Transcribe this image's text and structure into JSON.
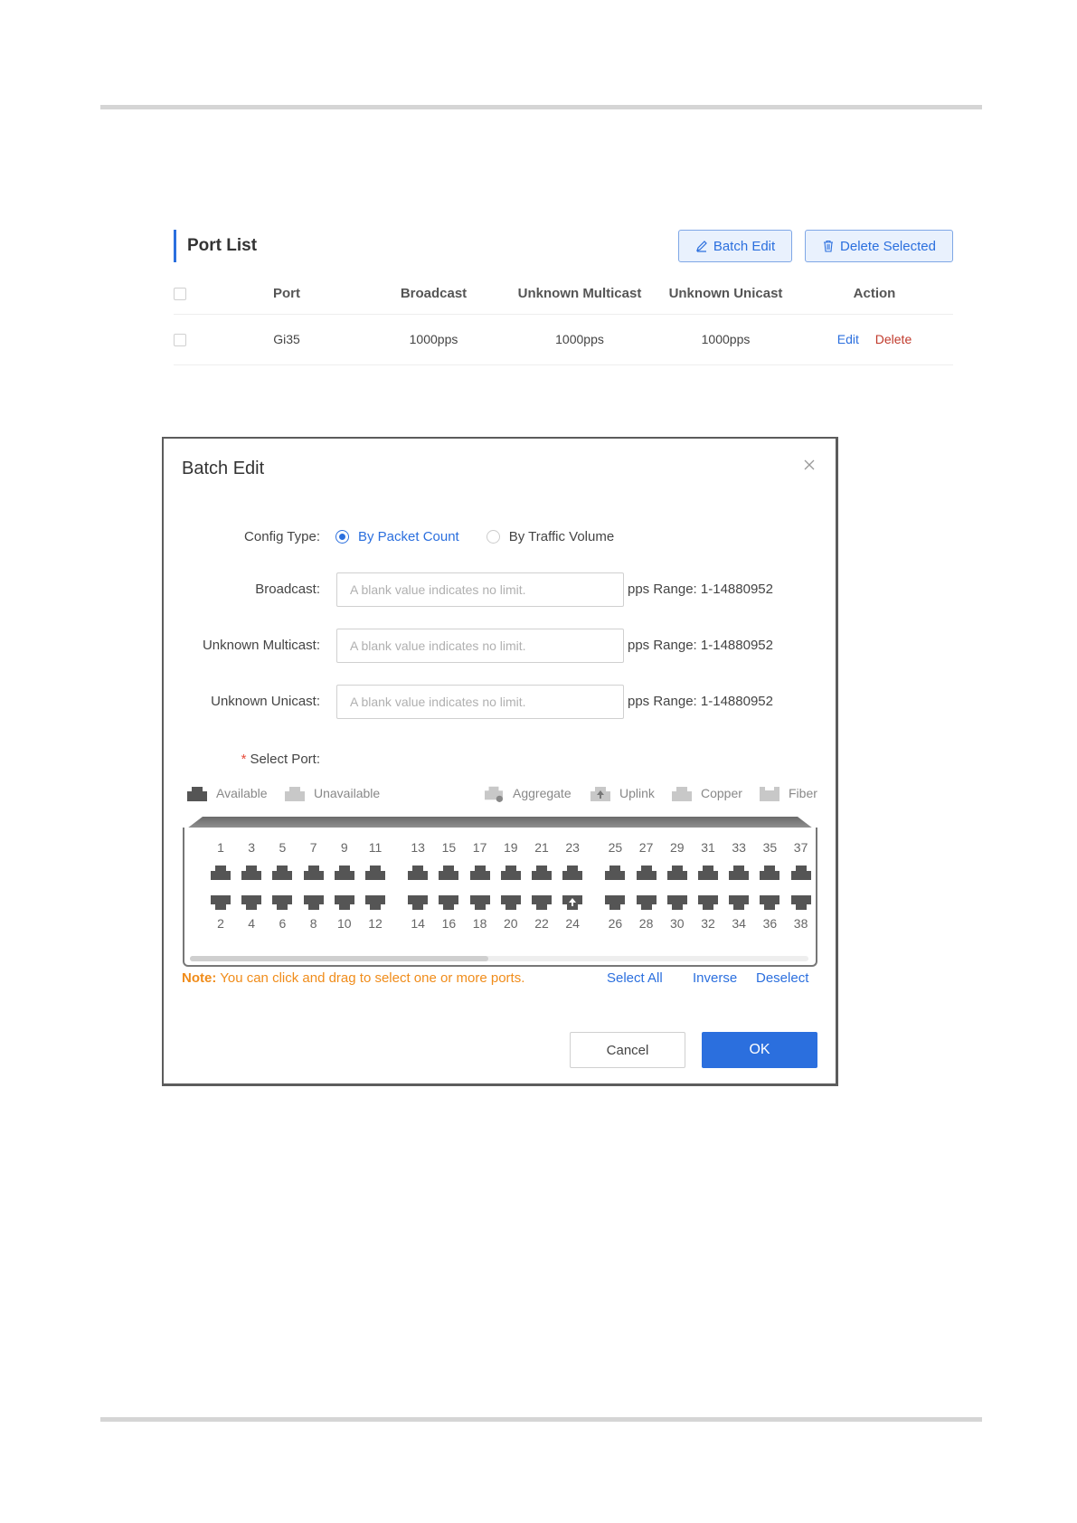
{
  "port_list": {
    "title": "Port List",
    "batch_edit_label": "Batch Edit",
    "delete_selected_label": "Delete Selected",
    "columns": [
      "Port",
      "Broadcast",
      "Unknown Multicast",
      "Unknown Unicast",
      "Action"
    ],
    "rows": [
      {
        "port": "Gi35",
        "broadcast": "1000pps",
        "multicast": "1000pps",
        "unicast": "1000pps",
        "edit": "Edit",
        "delete": "Delete"
      }
    ]
  },
  "modal": {
    "title": "Batch Edit",
    "config_type_label": "Config Type:",
    "option_packet": "By Packet Count",
    "option_traffic": "By Traffic Volume",
    "broadcast_label": "Broadcast:",
    "multicast_label": "Unknown Multicast:",
    "unicast_label": "Unknown Unicast:",
    "placeholder": "A blank value indicates no limit.",
    "range_text": "pps Range: 1-14880952",
    "select_port_label": "Select Port:",
    "legend": {
      "available": "Available",
      "unavailable": "Unavailable",
      "aggregate": "Aggregate",
      "uplink": "Uplink",
      "copper": "Copper",
      "fiber": "Fiber"
    },
    "odd_ports": [
      "1",
      "3",
      "5",
      "7",
      "9",
      "11",
      "13",
      "15",
      "17",
      "19",
      "21",
      "23",
      "25",
      "27",
      "29",
      "31",
      "33",
      "35",
      "37"
    ],
    "even_ports": [
      "2",
      "4",
      "6",
      "8",
      "10",
      "12",
      "14",
      "16",
      "18",
      "20",
      "22",
      "24",
      "26",
      "28",
      "30",
      "32",
      "34",
      "36",
      "38"
    ],
    "uplink_port": "24",
    "note_prefix": "Note:",
    "note_text": "You can click and drag to select one or more ports.",
    "select_all": "Select All",
    "inverse": "Inverse",
    "deselect": "Deselect",
    "cancel": "Cancel",
    "ok": "OK"
  },
  "colors": {
    "accent": "#2b6fde",
    "danger": "#c0392b",
    "note": "#f08c1a",
    "port_available": "#555555",
    "port_unavailable": "#c8c8c8"
  }
}
